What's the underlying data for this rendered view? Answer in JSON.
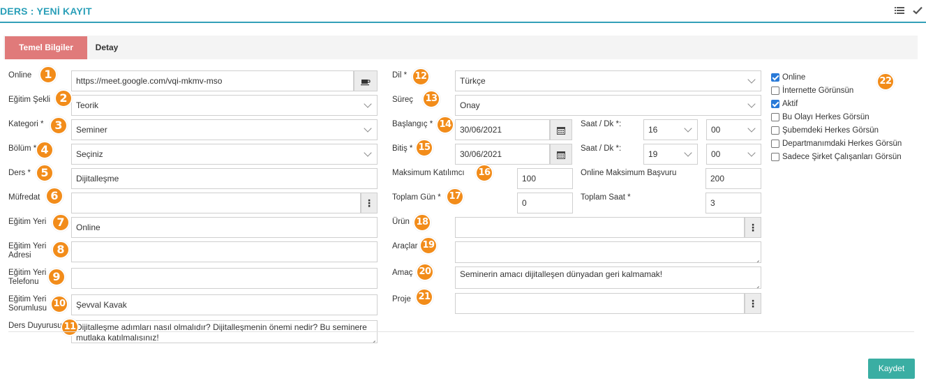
{
  "header": {
    "title": "DERS : YENİ KAYIT"
  },
  "tabs": [
    {
      "label": "Temel Bilgiler"
    },
    {
      "label": "Detay"
    }
  ],
  "left": {
    "online": {
      "label": "Online",
      "value": "https://meet.google.com/vqi-mkmv-mso",
      "icon": "meeting-icon"
    },
    "egitim_sekli": {
      "label": "Eğitim Şekli",
      "value": "Teorik"
    },
    "kategori": {
      "label": "Kategori *",
      "value": "Seminer"
    },
    "bolum": {
      "label": "Bölüm *",
      "value": "Seçiniz"
    },
    "ders": {
      "label": "Ders *",
      "value": "Dijitalleşme"
    },
    "mufredat": {
      "label": "Müfredat",
      "value": ""
    },
    "egitim_yeri": {
      "label": "Eğitim Yeri",
      "value": "Online"
    },
    "egitim_yeri_adresi": {
      "label1": "Eğitim Yeri",
      "label2": "Adresi",
      "value": ""
    },
    "egitim_yeri_telefonu": {
      "label1": "Eğitim Yeri",
      "label2": "Telefonu",
      "value": ""
    },
    "egitim_yeri_sorumlusu": {
      "label1": "Eğitim Yeri",
      "label2": "Sorumlusu",
      "value": "Şevval Kavak"
    },
    "ders_duyurusu": {
      "label": "Ders Duyurusu",
      "line1": "Dijitalleşme adımları nasıl olmalıdır? Dijitalleşmenin önemi nedir? Bu seminere",
      "line2": "mutlaka katılmalısınız!"
    }
  },
  "mid": {
    "dil": {
      "label": "Dil *",
      "value": "Türkçe"
    },
    "surec": {
      "label": "Süreç",
      "value": "Onay"
    },
    "baslangic": {
      "label": "Başlangıç *",
      "date": "30/06/2021",
      "time_label": "Saat / Dk *:",
      "hour": "16",
      "minute": "00"
    },
    "bitis": {
      "label": "Bitiş *",
      "date": "30/06/2021",
      "time_label": "Saat / Dk *:",
      "hour": "19",
      "minute": "00"
    },
    "maks_katilimci": {
      "label": "Maksimum Katılımcı",
      "value": "100"
    },
    "online_maks": {
      "label": "Online Maksimum Başvuru",
      "value": "200"
    },
    "toplam_gun": {
      "label": "Toplam Gün *",
      "value": "0"
    },
    "toplam_saat": {
      "label": "Toplam Saat *",
      "value": "3"
    },
    "urun": {
      "label": "Ürün",
      "value": ""
    },
    "araclar": {
      "label": "Araçlar",
      "value": ""
    },
    "amac": {
      "label": "Amaç",
      "value": "Seminerin amacı dijitalleşen dünyadan geri kalmamak!"
    },
    "proje": {
      "label": "Proje",
      "value": ""
    }
  },
  "checkboxes": [
    {
      "label": "Online",
      "checked": true
    },
    {
      "label": "İnternette Görünsün",
      "checked": false
    },
    {
      "label": "Aktif",
      "checked": true
    },
    {
      "label": "Bu Olayı Herkes Görsün",
      "checked": false
    },
    {
      "label": "Şubemdeki Herkes Görsün",
      "checked": false
    },
    {
      "label": "Departmanımdaki Herkes Görsün",
      "checked": false
    },
    {
      "label": "Sadece Şirket Çalışanları Görsün",
      "checked": false
    }
  ],
  "badges": [
    "1",
    "2",
    "3",
    "4",
    "5",
    "6",
    "7",
    "8",
    "9",
    "10",
    "11",
    "12",
    "13",
    "14",
    "15",
    "16",
    "17",
    "18",
    "19",
    "20",
    "21",
    "22"
  ],
  "footer": {
    "save_label": "Kaydet"
  },
  "colors": {
    "accent": "#2a9fb8",
    "tab_active": "#e07a7a",
    "badge": "#f28c1a",
    "save": "#3aaea3",
    "checkbox": "#2a7ad8"
  }
}
